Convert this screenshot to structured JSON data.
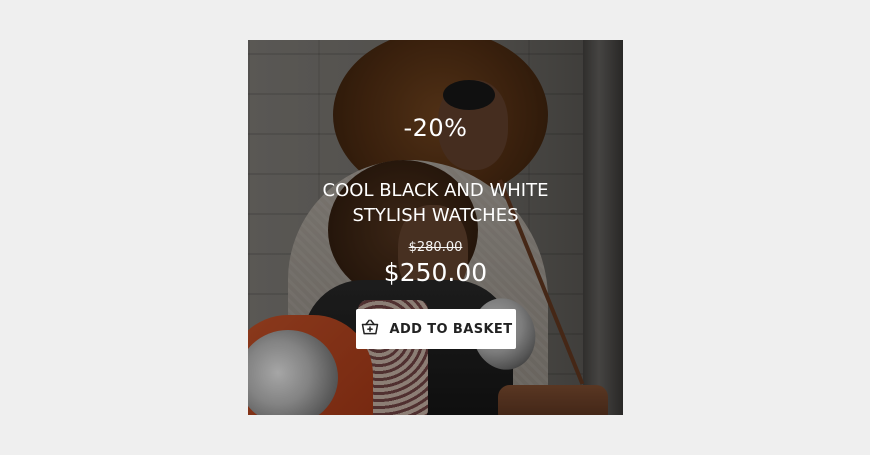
{
  "product": {
    "discount": "-20%",
    "title_line1": "COOL BLACK AND WHITE",
    "title_line2": "STYLISH WATCHES",
    "old_price": "$280.00",
    "price": "$250.00"
  },
  "cta": {
    "label": "ADD TO BASKET",
    "icon": "basket-add-icon"
  },
  "colors": {
    "page_bg": "#efefef",
    "text": "#ffffff",
    "button_bg": "#ffffff",
    "button_text": "#222222",
    "overlay": "rgba(0,0,0,0.35)"
  }
}
